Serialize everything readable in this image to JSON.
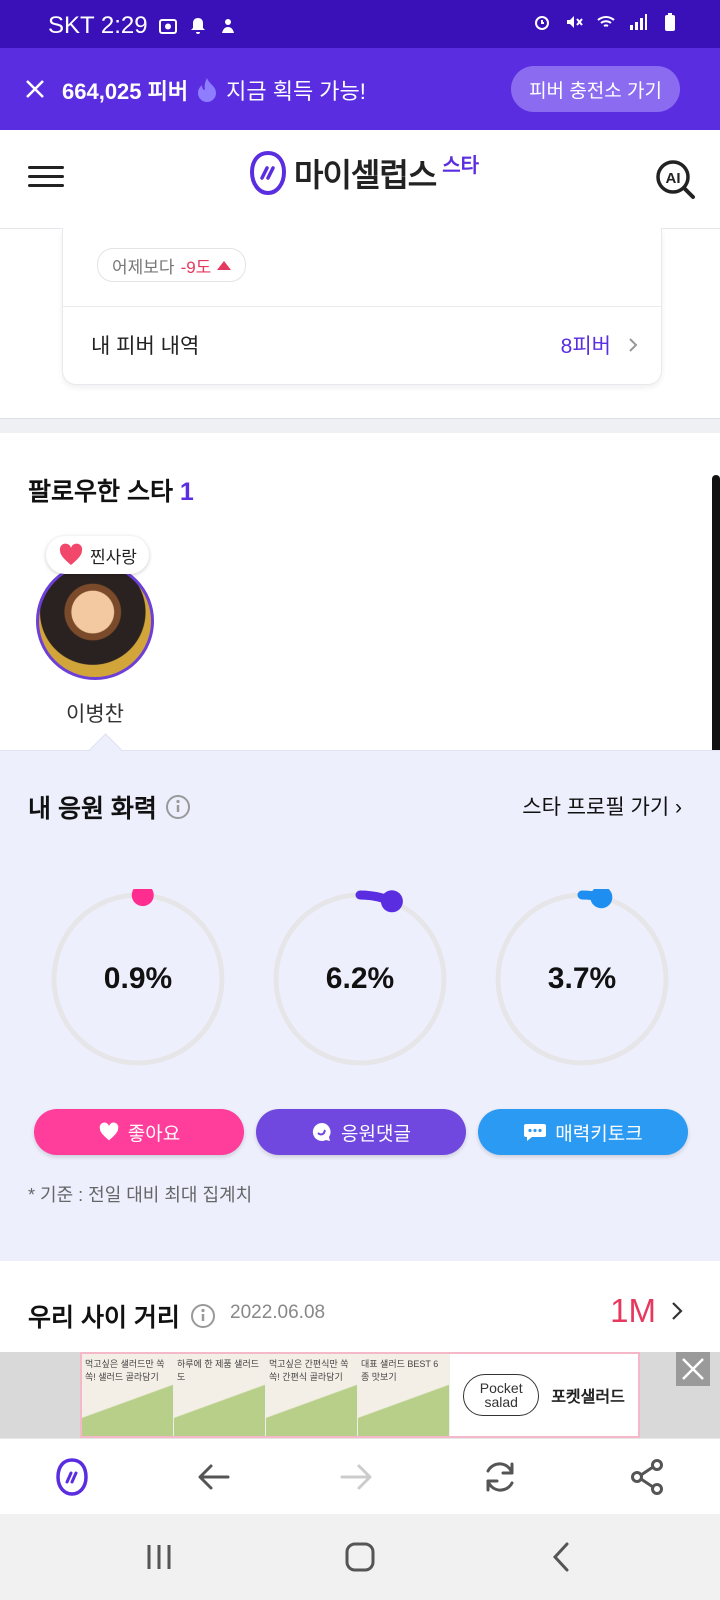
{
  "status_bar": {
    "carrier_time": "SKT 2:29"
  },
  "banner": {
    "fever_count": "664,025 피버",
    "message": "지금 획득 가능!",
    "cta": "피버 충전소 가기"
  },
  "header": {
    "logo_text": "마이셀럽스",
    "logo_sup": "스타"
  },
  "fever_card": {
    "diff_label": "어제보다",
    "diff_value": "-9도",
    "history_label": "내 피버 내역",
    "history_value": "8피버"
  },
  "following": {
    "title": "팔로우한 스타",
    "count": "1",
    "badge": "찐사랑",
    "star_name": "이병찬"
  },
  "support": {
    "title": "내 응원 화력",
    "profile_link": "스타 프로필 가기",
    "rings": [
      {
        "value": "0.9%",
        "fraction": 0.009,
        "color": "#ff2d8f"
      },
      {
        "value": "6.2%",
        "fraction": 0.062,
        "color": "#5a2ee0"
      },
      {
        "value": "3.7%",
        "fraction": 0.037,
        "color": "#1e8ff0"
      }
    ],
    "buttons": [
      {
        "label": "좋아요",
        "color": "#ff3d9a"
      },
      {
        "label": "응원댓글",
        "color": "#7048e0"
      },
      {
        "label": "매력키토크",
        "color": "#2b9af3"
      }
    ],
    "basis_note": "* 기준 : 전일 대비 최대 집계치"
  },
  "distance": {
    "title": "우리 사이 거리",
    "date": "2022.06.08",
    "value": "1M"
  },
  "ad": {
    "tiles": [
      "먹고싶은 샐러드만 쏙쏙! 샐러드 골라담기",
      "하루에 한 제품 샐러드도",
      "먹고싶은 간편식만 쏙쏙! 간편식 골라담기",
      "대표 샐러드 BEST 6종 맛보기"
    ],
    "logo_line1": "Pocket",
    "logo_line2": "salad",
    "brand": "포켓샐러드"
  }
}
